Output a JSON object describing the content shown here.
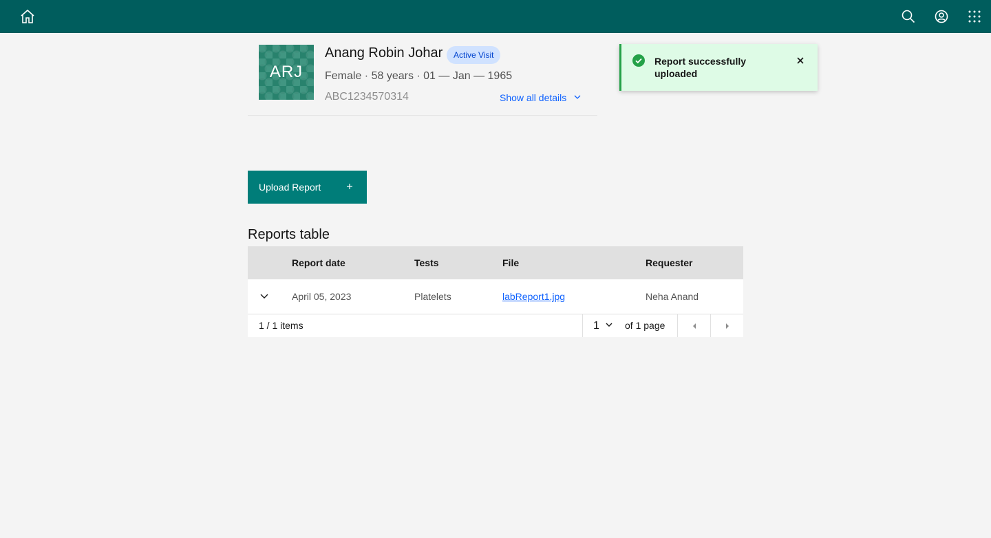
{
  "header": {
    "icons": [
      "home-icon",
      "search-icon",
      "user-avatar-icon",
      "app-switcher-icon"
    ],
    "bg_color": "#005d5d"
  },
  "patient": {
    "initials": "ARJ",
    "name": "Anang Robin Johar",
    "visit_tag": "Active Visit",
    "meta": "Female · 58 years · 01 — Jan — 1965",
    "id": "ABC1234570314",
    "show_details": "Show all details"
  },
  "toast": {
    "message": "Report successfully uploaded",
    "status_color": "#24a148"
  },
  "upload": {
    "label": "Upload Report"
  },
  "reports": {
    "title": "Reports table",
    "columns": [
      "Report date",
      "Tests",
      "File",
      "Requester"
    ],
    "rows": [
      {
        "date": "April 05, 2023",
        "tests": "Platelets",
        "file": "labReport1.jpg",
        "requester": "Neha Anand"
      }
    ],
    "pagination": {
      "items": "1 / 1 items",
      "page": "1",
      "of_pages": "of 1 page"
    }
  }
}
